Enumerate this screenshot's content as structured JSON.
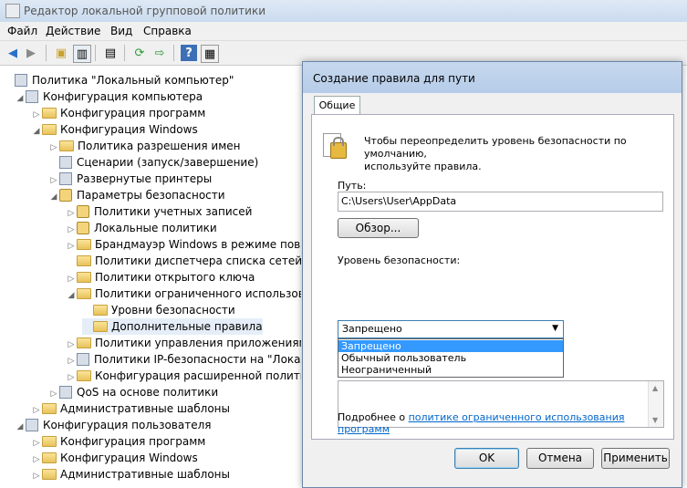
{
  "window": {
    "title": "Редактор локальной групповой политики"
  },
  "menu": [
    "Файл",
    "Действие",
    "Вид",
    "Справка"
  ],
  "toolbar": {
    "icons": [
      "back-icon",
      "forward-icon",
      "up-folder-icon",
      "show-hide-tree-icon",
      "properties-icon",
      "refresh-icon",
      "export-list-icon",
      "help-icon",
      "console-view-icon"
    ]
  },
  "tree": [
    {
      "label": "Политика \"Локальный компьютер\"",
      "level": 0,
      "icon": "policy",
      "tw": ""
    },
    {
      "label": "Конфигурация компьютера",
      "level": 1,
      "icon": "computer",
      "tw": "◢"
    },
    {
      "label": "Конфигурация программ",
      "level": 2,
      "icon": "folder",
      "tw": "▷"
    },
    {
      "label": "Конфигурация Windows",
      "level": 2,
      "icon": "folder",
      "tw": "◢"
    },
    {
      "label": "Политика разрешения имен",
      "level": 3,
      "icon": "folder",
      "tw": "▷"
    },
    {
      "label": "Сценарии (запуск/завершение)",
      "level": 3,
      "icon": "page",
      "tw": ""
    },
    {
      "label": "Развернутые принтеры",
      "level": 3,
      "icon": "page",
      "tw": "▷"
    },
    {
      "label": "Параметры безопасности",
      "level": 3,
      "icon": "lock",
      "tw": "◢"
    },
    {
      "label": "Политики учетных записей",
      "level": 4,
      "icon": "lock",
      "tw": "▷"
    },
    {
      "label": "Локальные политики",
      "level": 4,
      "icon": "lock",
      "tw": "▷"
    },
    {
      "label": "Брандмауэр Windows в режиме повыш",
      "level": 4,
      "icon": "folder",
      "tw": "▷"
    },
    {
      "label": "Политики диспетчера списка сетей",
      "level": 4,
      "icon": "folder",
      "tw": ""
    },
    {
      "label": "Политики открытого ключа",
      "level": 4,
      "icon": "folder",
      "tw": "▷"
    },
    {
      "label": "Политики ограниченного использован",
      "level": 4,
      "icon": "folder",
      "tw": "◢"
    },
    {
      "label": "Уровни безопасности",
      "level": 5,
      "icon": "folder",
      "tw": ""
    },
    {
      "label": "Дополнительные правила",
      "level": 5,
      "icon": "folder",
      "tw": "",
      "selected": true
    },
    {
      "label": "Политики управления приложениями",
      "level": 4,
      "icon": "folder",
      "tw": "▷"
    },
    {
      "label": "Политики IP-безопасности на \"Локаль",
      "level": 4,
      "icon": "page",
      "tw": "▷"
    },
    {
      "label": "Конфигурация расширенной политики",
      "level": 4,
      "icon": "folder",
      "tw": "▷"
    },
    {
      "label": "QoS на основе политики",
      "level": 3,
      "icon": "chart",
      "tw": "▷"
    },
    {
      "label": "Административные шаблоны",
      "level": 2,
      "icon": "folder",
      "tw": "▷"
    },
    {
      "label": "Конфигурация пользователя",
      "level": 1,
      "icon": "user",
      "tw": "◢"
    },
    {
      "label": "Конфигурация программ",
      "level": 2,
      "icon": "folder",
      "tw": "▷"
    },
    {
      "label": "Конфигурация Windows",
      "level": 2,
      "icon": "folder",
      "tw": "▷"
    },
    {
      "label": "Административные шаблоны",
      "level": 2,
      "icon": "folder",
      "tw": "▷"
    }
  ],
  "dialog": {
    "title": "Создание правила для пути",
    "tab": "Общие",
    "info": "Чтобы переопределить уровень безопасности по умолчанию,\nиспользуйте правила.",
    "path_label": "Путь:",
    "path_value": "C:\\Users\\User\\AppData",
    "browse": "Обзор...",
    "security_label": "Уровень безопасности:",
    "security_value": "Запрещено",
    "options": [
      "Запрещено",
      "Обычный пользователь",
      "Неограниченный"
    ],
    "more_prefix": "Подробнее о ",
    "more_link": "политике ограниченного использования программ",
    "ok": "OK",
    "cancel": "Отмена",
    "apply": "Применить"
  }
}
